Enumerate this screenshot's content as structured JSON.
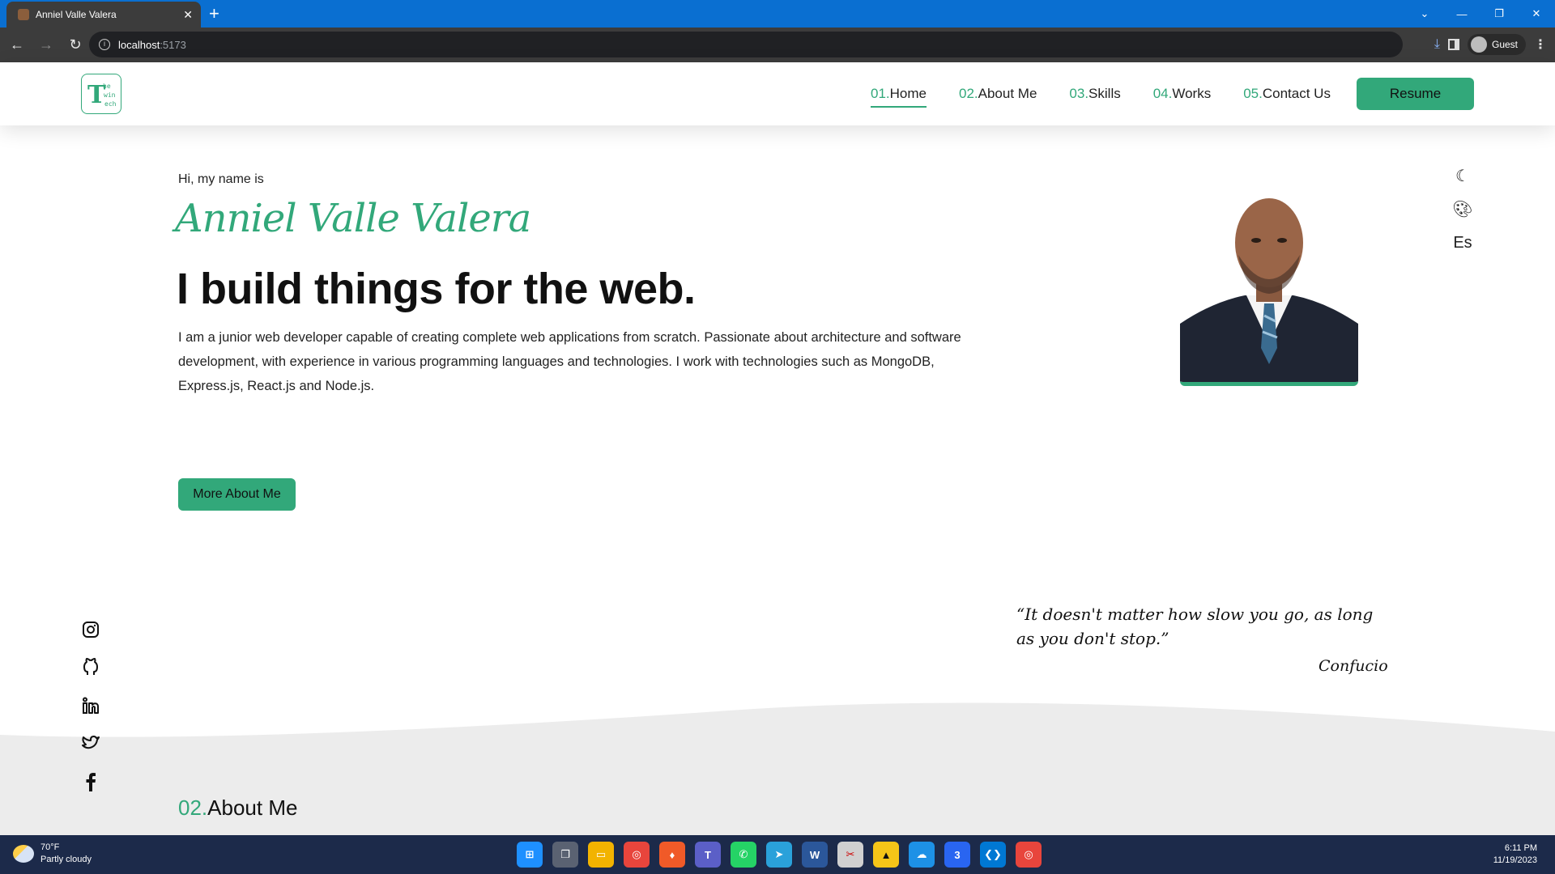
{
  "browser": {
    "tab_title": "Anniel Valle Valera",
    "url_host": "localhost",
    "url_port": ":5173",
    "profile_label": "Guest"
  },
  "nav": {
    "logo_letter": "T",
    "logo_small": [
      "he",
      "win",
      "ech"
    ],
    "links": [
      {
        "num": "01.",
        "label": "Home"
      },
      {
        "num": "02.",
        "label": "About Me"
      },
      {
        "num": "03.",
        "label": "Skills"
      },
      {
        "num": "04.",
        "label": "Works"
      },
      {
        "num": "05.",
        "label": "Contact Us"
      }
    ],
    "resume_label": "Resume"
  },
  "hero": {
    "greeting": "Hi, my name is",
    "name": "Anniel Valle Valera",
    "title": "I build things for the web.",
    "description": "I am a junior web developer capable of creating complete web applications from scratch. Passionate about architecture and software development, with experience in various programming languages and technologies. I work with technologies such as MongoDB, Express.js, React.js and Node.js.",
    "cta_label": "More About Me"
  },
  "tools": {
    "lang_label": "Es",
    "icons": [
      "moon-icon",
      "palette-icon"
    ]
  },
  "quote": {
    "text": "“It doesn't matter how slow you go, as long as you don't stop.”",
    "author": "Confucio"
  },
  "social": [
    "instagram-icon",
    "github-icon",
    "linkedin-icon",
    "twitter-icon",
    "facebook-icon"
  ],
  "about": {
    "num": "02.",
    "label": "About Me"
  },
  "taskbar": {
    "temp": "70°F",
    "weather": "Partly cloudy",
    "time": "6:11 PM",
    "date": "11/19/2023"
  },
  "colors": {
    "accent": "#32a87a",
    "chrome_blue": "#0a6fd1",
    "taskbar": "#1c2a4a"
  }
}
